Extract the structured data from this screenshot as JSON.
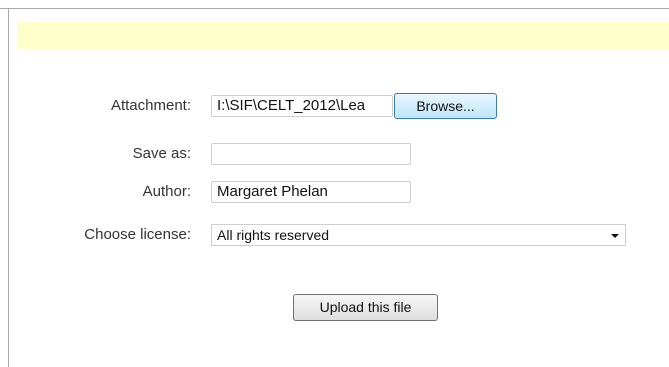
{
  "form": {
    "attachment": {
      "label": "Attachment:",
      "value": "I:\\SIF\\CELT_2012\\Lea",
      "browse_label": "Browse..."
    },
    "save_as": {
      "label": "Save as:",
      "value": ""
    },
    "author": {
      "label": "Author:",
      "value": "Margaret Phelan"
    },
    "license": {
      "label": "Choose license:",
      "selected": "All rights reserved"
    },
    "upload_label": "Upload this file"
  },
  "colors": {
    "notice_bar": "#ffffcc",
    "browse_border": "#3d7bad"
  }
}
